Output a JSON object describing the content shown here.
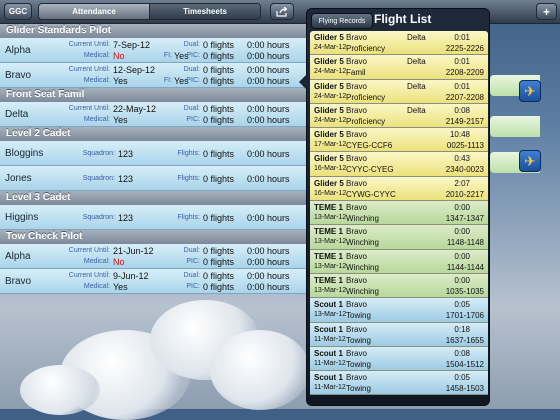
{
  "topbar": {
    "ggc": "GGC",
    "tabs": [
      "Attendance",
      "Timesheets"
    ],
    "add": "+",
    "share_icon": "share-icon"
  },
  "labels": {
    "current_until": "Current Until:",
    "medical": "Medical:",
    "dual": "Dual:",
    "fi": "FI:",
    "pic": "PIC:",
    "squadron": "Squadron:",
    "flights": "Flights:"
  },
  "sections": [
    {
      "title": "Glider Standards Pilot",
      "rows": [
        {
          "name": "Alpha",
          "current": "7-Sep-12",
          "medical": "No",
          "fi": "Yes",
          "dual": "0 flights",
          "dual_h": "0:00 hours",
          "pic": "0 flights",
          "pic_h": "0:00 hours"
        },
        {
          "name": "Bravo",
          "current": "12-Sep-12",
          "medical": "Yes",
          "fi": "Yes",
          "dual": "0 flights",
          "dual_h": "0:00 hours",
          "pic": "0 flights",
          "pic_h": "0:00 hours"
        }
      ]
    },
    {
      "title": "Front Seat Famil",
      "rows": [
        {
          "name": "Delta",
          "current": "22-May-12",
          "medical": "Yes",
          "dual": "0 flights",
          "dual_h": "0:00 hours",
          "pic": "0 flights",
          "pic_h": "0:00 hours"
        }
      ]
    },
    {
      "title": "Level 2 Cadet",
      "rows": [
        {
          "name": "Bloggins",
          "squadron": "123",
          "flights": "0 flights",
          "hours": "0:00 hours"
        },
        {
          "name": "Jones",
          "squadron": "123",
          "flights": "0 flights",
          "hours": "0:00 hours"
        }
      ]
    },
    {
      "title": "Level 3 Cadet",
      "rows": [
        {
          "name": "Higgins",
          "squadron": "123",
          "flights": "0 flights",
          "hours": "0:00 hours"
        }
      ]
    },
    {
      "title": "Tow Check Pilot",
      "rows": [
        {
          "name": "Alpha",
          "current": "21-Jun-12",
          "medical": "No",
          "dual": "0 flights",
          "dual_h": "0:00 hours",
          "pic": "0 flights",
          "pic_h": "0:00 hours"
        },
        {
          "name": "Bravo",
          "current": "9-Jun-12",
          "medical": "Yes",
          "dual": "0 flights",
          "dual_h": "0:00 hours",
          "pic": "0 flights",
          "pic_h": "0:00 hours"
        }
      ]
    }
  ],
  "popover": {
    "button": "Flying Records",
    "title": "Flight List",
    "flights": [
      {
        "ac": "Glider 5",
        "date": "24-Mar-12",
        "p1": "Bravo",
        "p2": "Delta",
        "type": "Proficiency",
        "dur": "0:01",
        "time": "2225-2226",
        "color": "y"
      },
      {
        "ac": "Glider 5",
        "date": "24-Mar-12",
        "p1": "Bravo",
        "p2": "Delta",
        "type": "Famil",
        "dur": "0:01",
        "time": "2208-2209",
        "color": "y"
      },
      {
        "ac": "Glider 5",
        "date": "24-Mar-12",
        "p1": "Bravo",
        "p2": "Delta",
        "type": "Proficiency",
        "dur": "0:01",
        "time": "2207-2208",
        "color": "y"
      },
      {
        "ac": "Glider 5",
        "date": "24-Mar-12",
        "p1": "Bravo",
        "p2": "Delta",
        "type": "Proficiency",
        "dur": "0:08",
        "time": "2149-2157",
        "color": "y"
      },
      {
        "ac": "Glider 5",
        "date": "17-Mar-12",
        "p1": "Bravo",
        "p2": "",
        "type": "CYEG-CCF6",
        "dur": "10:48",
        "time": "0025-1113",
        "color": "y"
      },
      {
        "ac": "Glider 5",
        "date": "16-Mar-12",
        "p1": "Bravo",
        "p2": "",
        "type": "CYYC-CYEG",
        "dur": "0:43",
        "time": "2340-0023",
        "color": "y"
      },
      {
        "ac": "Glider 5",
        "date": "16-Mar-12",
        "p1": "Bravo",
        "p2": "",
        "type": "CYWG-CYYC",
        "dur": "2:07",
        "time": "2010-2217",
        "color": "y"
      },
      {
        "ac": "TEME 1",
        "date": "13-Mar-12",
        "p1": "Bravo",
        "p2": "",
        "type": "Winching",
        "dur": "0:00",
        "time": "1347-1347",
        "color": "g"
      },
      {
        "ac": "TEME 1",
        "date": "13-Mar-12",
        "p1": "Bravo",
        "p2": "",
        "type": "Winching",
        "dur": "0:00",
        "time": "1148-1148",
        "color": "g"
      },
      {
        "ac": "TEME 1",
        "date": "13-Mar-12",
        "p1": "Bravo",
        "p2": "",
        "type": "Winching",
        "dur": "0:00",
        "time": "1144-1144",
        "color": "g"
      },
      {
        "ac": "TEME 1",
        "date": "13-Mar-12",
        "p1": "Bravo",
        "p2": "",
        "type": "Winching",
        "dur": "0:00",
        "time": "1035-1035",
        "color": "g"
      },
      {
        "ac": "Scout 1",
        "date": "13-Mar-12",
        "p1": "Bravo",
        "p2": "",
        "type": "Towing",
        "dur": "0:05",
        "time": "1701-1706",
        "color": "b"
      },
      {
        "ac": "Scout 1",
        "date": "11-Mar-12",
        "p1": "Bravo",
        "p2": "",
        "type": "Towing",
        "dur": "0:18",
        "time": "1637-1655",
        "color": "b"
      },
      {
        "ac": "Scout 1",
        "date": "11-Mar-12",
        "p1": "Bravo",
        "p2": "",
        "type": "Towing",
        "dur": "0:08",
        "time": "1504-1512",
        "color": "b"
      },
      {
        "ac": "Scout 1",
        "date": "11-Mar-12",
        "p1": "Bravo",
        "p2": "",
        "type": "Towing",
        "dur": "0:05",
        "time": "1458-1503",
        "color": "b"
      }
    ]
  }
}
